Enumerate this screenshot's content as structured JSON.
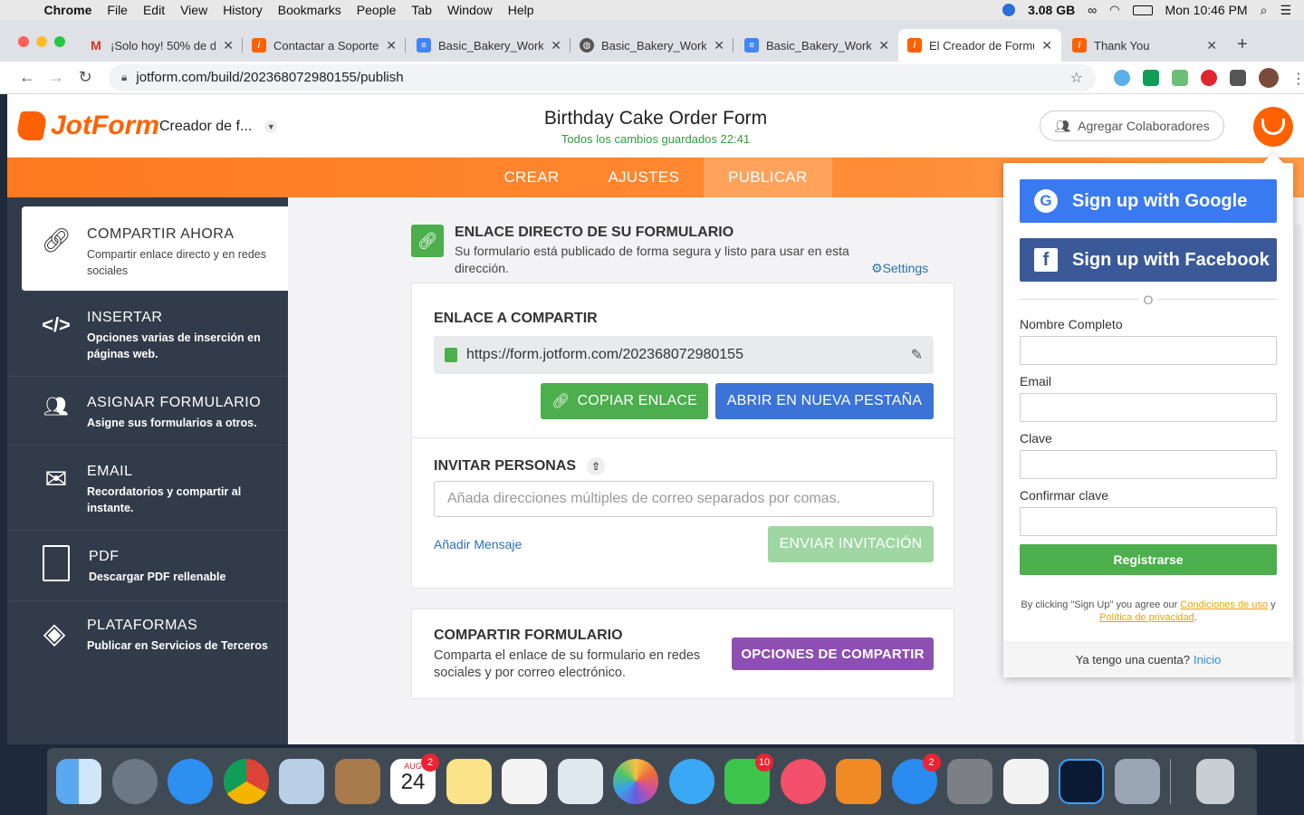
{
  "menubar": {
    "items": [
      "Chrome",
      "File",
      "Edit",
      "View",
      "History",
      "Bookmarks",
      "People",
      "Tab",
      "Window",
      "Help"
    ],
    "memory": "3.08 GB",
    "clock": "Mon 10:46 PM"
  },
  "tabs": [
    {
      "label": "¡Solo hoy! 50% de d",
      "icon": "gmail-icon",
      "color": "#ffffff"
    },
    {
      "label": "Contactar a Soporte",
      "icon": "jotform-icon",
      "color": "#ff6100"
    },
    {
      "label": "Basic_Bakery_Works",
      "icon": "docs-icon",
      "color": "#4285f4"
    },
    {
      "label": "Basic_Bakery_Works",
      "icon": "globe-icon",
      "color": "#555555"
    },
    {
      "label": "Basic_Bakery_Works",
      "icon": "docs-icon",
      "color": "#4285f4"
    },
    {
      "label": "El Creador de Formu",
      "icon": "jotform-icon",
      "color": "#ff6100"
    },
    {
      "label": "Thank You",
      "icon": "jotform-icon",
      "color": "#ff6100"
    }
  ],
  "address": {
    "url": "jotform.com/build/202368072980155/publish"
  },
  "header": {
    "logo": "JotForm",
    "form_name": "Creador de f...",
    "title": "Birthday Cake Order Form",
    "saved": "Todos los cambios guardados 22:41",
    "collab": "Agregar Colaboradores"
  },
  "nav": {
    "crear": "CREAR",
    "ajustes": "AJUSTES",
    "publicar": "PUBLICAR"
  },
  "sidebar": [
    {
      "title": "COMPARTIR AHORA",
      "desc": "Compartir enlace directo y en redes sociales"
    },
    {
      "title": "INSERTAR",
      "desc": "Opciones varias de inserción en páginas web."
    },
    {
      "title": "ASIGNAR FORMULARIO",
      "desc": "Asigne sus formularios a otros."
    },
    {
      "title": "EMAIL",
      "desc": "Recordatorios y compartir al instante."
    },
    {
      "title": "PDF",
      "desc": "Descargar PDF rellenable"
    },
    {
      "title": "PLATAFORMAS",
      "desc": "Publicar en Servicios de Terceros"
    }
  ],
  "direct": {
    "heading": "ENLACE DIRECTO DE SU FORMULARIO",
    "desc": "Su formulario está publicado de forma segura y listo para usar en esta dirección.",
    "settings": "Settings"
  },
  "share": {
    "heading": "ENLACE A COMPARTIR",
    "url": "https://form.jotform.com/202368072980155",
    "copy": "COPIAR ENLACE",
    "open": "ABRIR EN NUEVA PESTAÑA"
  },
  "invite": {
    "heading": "INVITAR PERSONAS",
    "placeholder": "Añada direcciones múltiples de correo separados por comas.",
    "add_message": "Añadir Mensaje",
    "send": "ENVIAR INVITACIÓN"
  },
  "shareform": {
    "heading": "COMPARTIR FORMULARIO",
    "desc": "Comparta el enlace de su formulario en redes sociales y por correo electrónico.",
    "options": "OPCIONES DE COMPARTIR"
  },
  "signup": {
    "google": "Sign up with Google",
    "facebook": "Sign up with Facebook",
    "or": "O",
    "name_label": "Nombre Completo",
    "email_label": "Email",
    "password_label": "Clave",
    "confirm_label": "Confirmar clave",
    "register": "Registrarse",
    "terms_prefix": "By clicking \"Sign Up\" you agree our",
    "terms_link": "Condiciones de uso",
    "terms_and": "y",
    "privacy_link": "Política de privacidad",
    "terms_suffix": ".",
    "have_account": "Ya tengo una cuenta?",
    "login": "Inicio"
  },
  "dock": {
    "calendar_month": "AUG",
    "calendar_day": "24",
    "badges": {
      "calendar": "2",
      "facetime": "10",
      "appstore": "2"
    }
  },
  "colors": {
    "brand": "#ff6100",
    "green": "#4cae4c",
    "blue": "#3b73d6",
    "purple": "#8e4fb3",
    "google_blue": "#3a7af0",
    "facebook": "#3b5998"
  }
}
